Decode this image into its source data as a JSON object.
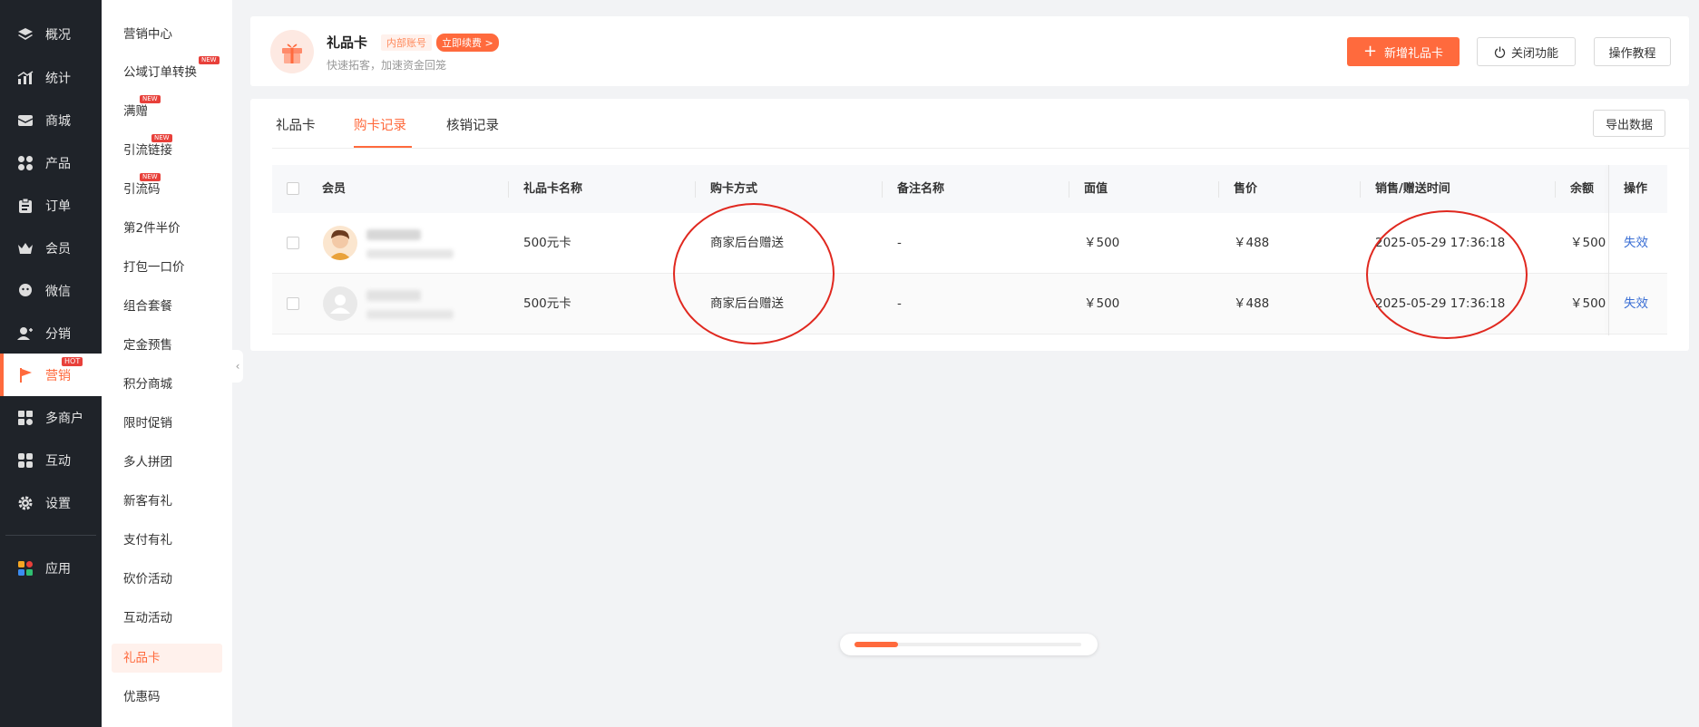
{
  "nav": {
    "items": [
      {
        "label": "概况",
        "icon": "layers-icon"
      },
      {
        "label": "统计",
        "icon": "chart-icon"
      },
      {
        "label": "商城",
        "icon": "mail-icon"
      },
      {
        "label": "产品",
        "icon": "grid-icon"
      },
      {
        "label": "订单",
        "icon": "clipboard-icon"
      },
      {
        "label": "会员",
        "icon": "crown-icon"
      },
      {
        "label": "微信",
        "icon": "chat-icon"
      },
      {
        "label": "分销",
        "icon": "user-share-icon"
      },
      {
        "label": "营销",
        "icon": "flag-icon",
        "badge": "HOT"
      },
      {
        "label": "多商户",
        "icon": "store-icon"
      },
      {
        "label": "互动",
        "icon": "blocks-icon"
      },
      {
        "label": "设置",
        "icon": "gear-icon"
      },
      {
        "label": "应用",
        "icon": "apps-icon"
      }
    ]
  },
  "submenu": {
    "items": [
      {
        "label": "营销中心"
      },
      {
        "label": "公域订单转换",
        "badge": "NEW"
      },
      {
        "label": "满赠",
        "badge": "NEW"
      },
      {
        "label": "引流链接",
        "badge": "NEW"
      },
      {
        "label": "引流码",
        "badge": "NEW"
      },
      {
        "label": "第2件半价"
      },
      {
        "label": "打包一口价"
      },
      {
        "label": "组合套餐"
      },
      {
        "label": "定金预售"
      },
      {
        "label": "积分商城"
      },
      {
        "label": "限时促销"
      },
      {
        "label": "多人拼团"
      },
      {
        "label": "新客有礼"
      },
      {
        "label": "支付有礼"
      },
      {
        "label": "砍价活动"
      },
      {
        "label": "互动活动"
      },
      {
        "label": "礼品卡"
      },
      {
        "label": "优惠码"
      }
    ],
    "collapse_glyph": "‹"
  },
  "header": {
    "title": "礼品卡",
    "tag_internal": "内部账号",
    "tag_renew": "立即续费 >",
    "subtitle": "快速拓客，加速资金回笼",
    "btn_new": "新增礼品卡",
    "btn_close": "关闭功能",
    "btn_tutorial": "操作教程"
  },
  "tabs": [
    {
      "label": "礼品卡"
    },
    {
      "label": "购卡记录"
    },
    {
      "label": "核销记录"
    }
  ],
  "export_label": "导出数据",
  "table": {
    "columns": [
      "会员",
      "礼品卡名称",
      "购卡方式",
      "备注名称",
      "面值",
      "售价",
      "销售/赠送时间",
      "余额",
      "操作"
    ],
    "rows": [
      {
        "card_name": "500元卡",
        "method": "商家后台赠送",
        "remark": "-",
        "face": "￥500",
        "price": "￥488",
        "time": "2025-05-29 17:36:18",
        "balance": "￥500",
        "action": "失效"
      },
      {
        "card_name": "500元卡",
        "method": "商家后台赠送",
        "remark": "-",
        "face": "￥500",
        "price": "￥488",
        "time": "2025-05-29 17:36:18",
        "balance": "￥500",
        "action": "失效"
      }
    ]
  },
  "scroll_progress": 0.19,
  "colors": {
    "accent": "#ff6a3d",
    "nav_bg": "#1f2329",
    "link": "#3b6fd4",
    "annotation": "#e0281f"
  }
}
